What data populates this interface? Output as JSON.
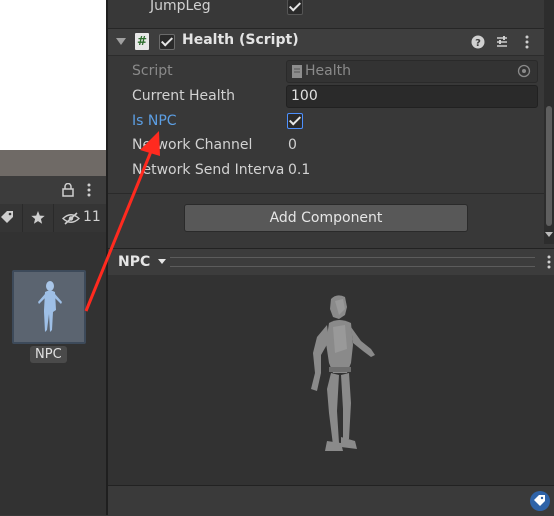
{
  "inspector": {
    "jumpleg_label": "JumpLeg",
    "component_title": "Health (Script)",
    "component_icon": "#",
    "fields": {
      "script_label": "Script",
      "script_value": "Health",
      "current_health_label": "Current Health",
      "current_health_value": "100",
      "is_npc_label": "Is NPC",
      "network_channel_label": "Network Channel",
      "network_channel_value": "0",
      "network_send_interval_label": "Network Send Interva",
      "network_send_interval_value": "0.1"
    },
    "add_component_label": "Add Component"
  },
  "left_panel": {
    "hidden_count": "11",
    "asset_label": "NPC"
  },
  "preview": {
    "dropdown_label": "NPC"
  },
  "colors": {
    "accent_checkbox": "#4d90fe",
    "annotation_arrow": "#ff2a1f",
    "link_label": "#4c9be8"
  }
}
